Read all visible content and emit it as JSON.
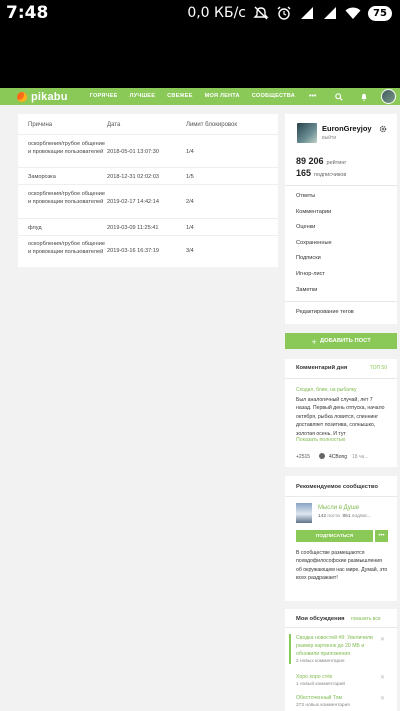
{
  "status_bar": {
    "time": "7:48",
    "network_speed": "0,0 КБ/с",
    "battery": "75",
    "icons": [
      "mute-icon",
      "alarm-icon",
      "signal-icon",
      "signal-icon",
      "wifi-icon",
      "battery-icon"
    ]
  },
  "header": {
    "logo": "pikabu",
    "nav": [
      "ГОРЯЧЕЕ",
      "ЛУЧШЕЕ",
      "СВЕЖЕЕ",
      "МОЯ ЛЕНТА",
      "СООБЩЕСТВА"
    ],
    "more": "•••",
    "icons": [
      "search-icon",
      "bell-icon",
      "avatar"
    ],
    "accent": "#8ac858"
  },
  "ban_table": {
    "headers": [
      "Причина",
      "Дата",
      "Лимит блокировок"
    ],
    "rows": [
      {
        "reason": "оскорбления/грубое общение и провокации пользователей",
        "date": "2018-05-01 13:07:30",
        "limit": "1/4"
      },
      {
        "reason": "Заморозка",
        "date": "2018-12-31 02:02:03",
        "limit": "1/5"
      },
      {
        "reason": "оскорбления/грубое общение и провокации пользователей",
        "date": "2019-02-17 14:42:14",
        "limit": "2/4"
      },
      {
        "reason": "флуд",
        "date": "2019-03-09 11:25:41",
        "limit": "1/4"
      },
      {
        "reason": "оскорбления/грубое общение и провокации пользователей",
        "date": "2019-03-16 16:37:19",
        "limit": "3/4"
      }
    ]
  },
  "profile": {
    "username": "EuronGreyjoy",
    "logout": "выйти",
    "rating_value": "89 206",
    "rating_label": "рейтинг",
    "subscribers_value": "165",
    "subscribers_label": "подписчиков",
    "menu": [
      "Ответы",
      "Комментарии",
      "Оценки",
      "Сохраненные",
      "Подписки",
      "Игнор-лист",
      "Заметки"
    ],
    "tags_edit": "Редактирование тегов"
  },
  "add_post": {
    "label": "ДОБАВИТЬ ПОСТ",
    "icon": "plus-icon"
  },
  "comment_of_day": {
    "title": "Комментарий дня",
    "top_link": "ТОП 50",
    "post_title": "Сходил, блин, на рыбалку",
    "text": "Был аналогичный случай, лет 7 назад. Первый день отпуска, начало октября, рыбка ловится, спиннинг доставляет позитива, солнышко, золотая осень. И тут",
    "more": "Показать полностью",
    "rating": "+2515",
    "user": "4CBong",
    "time": "18 ча..."
  },
  "recommended_community": {
    "title": "Рекомендуемое сообщество",
    "name": "Мысли в Душе",
    "posts": "142",
    "posts_label": "поста",
    "subscribers": "851",
    "subscribers_label": "подпис...",
    "subscribe_button": "ПОДПИСАТЬСЯ",
    "more": "•••",
    "description": "В сообществе размещаются псевдофилософские размышления об окружающем нас мире. Думай, это всех раздражает!"
  },
  "my_discussions": {
    "title": "Мои обсуждения",
    "show_all": "показать все",
    "items": [
      {
        "title": "Сводка новостей #9: Увеличили размер картинок до 20 МБ и обновили приложения",
        "count": "2 новых комментария"
      },
      {
        "title": "Хоpo хоpo стёк",
        "count": "1 новый комментарий"
      },
      {
        "title": "Обесточенный Том",
        "count": "273 новых комментария"
      }
    ]
  }
}
